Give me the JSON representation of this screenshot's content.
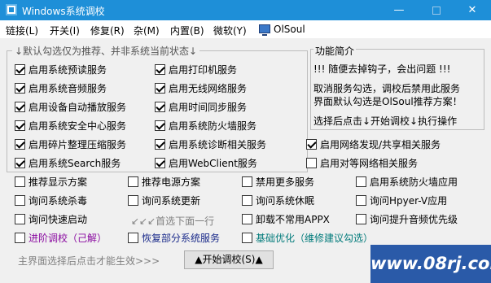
{
  "window": {
    "title": "Windows系统调校",
    "minimize": "—",
    "maximize": "",
    "close": "✕"
  },
  "menu": [
    "链接(L)",
    "开关(I)",
    "修复(R)",
    "杂(M)",
    "内置(B)",
    "微软(Y)",
    "OlSoul"
  ],
  "group": {
    "title": "↓默认勾选仅为推荐、并非系统当前状态↓"
  },
  "checkboxes": {
    "col1": [
      {
        "label": "启用系统预读服务",
        "checked": true
      },
      {
        "label": "启用系统音频服务",
        "checked": true
      },
      {
        "label": "启用设备自动播放服务",
        "checked": true
      },
      {
        "label": "启用系统安全中心服务",
        "checked": true
      },
      {
        "label": "启用碎片整理压缩服务",
        "checked": true
      },
      {
        "label": "启用系统Search服务",
        "checked": true
      }
    ],
    "col2": [
      {
        "label": "启用打印机服务",
        "checked": true
      },
      {
        "label": "启用无线网络服务",
        "checked": true
      },
      {
        "label": "启用时间同步服务",
        "checked": true
      },
      {
        "label": "启用系统防火墙服务",
        "checked": true
      },
      {
        "label": "启用系统诊断相关服务",
        "checked": true
      },
      {
        "label": "启用WebClient服务",
        "checked": true
      }
    ],
    "col3": [
      {
        "label": "启用网络发现/共享相关服务",
        "checked": true
      },
      {
        "label": "启用对等网络相关服务",
        "checked": false
      }
    ],
    "grid": [
      [
        {
          "label": "推荐显示方案"
        },
        {
          "label": "推荐电源方案"
        },
        {
          "label": "禁用更多服务"
        },
        {
          "label": "启用系统防火墙应用"
        }
      ],
      [
        {
          "label": "询问系统杀毒"
        },
        {
          "label": "询问系统更新"
        },
        {
          "label": "询问系统休眠"
        },
        {
          "label": "询问Hpyer-V应用"
        }
      ],
      [
        {
          "label": "询问快速启动"
        },
        {
          "label": ""
        },
        {
          "label": "卸载不常用APPX"
        },
        {
          "label": "询问提升音频优先级"
        }
      ],
      [
        {
          "label": "进阶调校（己解）",
          "color": "#8a0aa0"
        },
        {
          "label": "恢复部分系统服务",
          "color": "#1a2a8a"
        },
        {
          "label": "基础优化（维修建议勾选）",
          "color": "#007a7a"
        },
        {
          "label": ""
        }
      ]
    ]
  },
  "hint_first_row": "↙↙↙首选下面一行",
  "func": {
    "title": "功能简介",
    "lines": [
      "!!! 随便去掉钩子，会出问题 !!!",
      "取消服务勾选，调校后禁用此服务",
      "界面默认勾选是OlSoul推荐方案！",
      "选择后点击↓开始调校↓执行操作"
    ]
  },
  "bottom": {
    "note": "主界面选择后点击才能生效>>>",
    "start_button": "▲开始调校(S)▲"
  },
  "watermark": "www.08rj.com"
}
